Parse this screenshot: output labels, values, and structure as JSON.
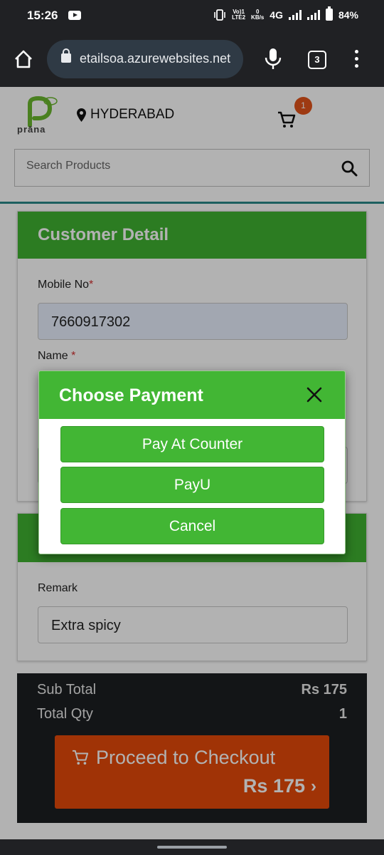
{
  "status_bar": {
    "time": "15:26",
    "net_line1": "Vo)1",
    "net_line2": "LTE2",
    "speed_line1": "0",
    "speed_line2": "KB/s",
    "network": "4G",
    "battery": "84%"
  },
  "browser": {
    "url": "etailsoa.azurewebsites.net",
    "tab_count": "3"
  },
  "header": {
    "logo_text": "prāna",
    "city": "HYDERABAD",
    "cart_count": "1"
  },
  "search": {
    "placeholder": "Search Products"
  },
  "customer_detail": {
    "title": "Customer Detail",
    "mobile_label": "Mobile No",
    "mobile_value": "7660917302",
    "name_label": "Name ",
    "required_mark": "*"
  },
  "remark_section": {
    "label": "Remark",
    "value": "Extra spicy"
  },
  "summary": {
    "subtotal_label": "Sub Total",
    "subtotal_value": "Rs 175",
    "qty_label": "Total Qty",
    "qty_value": "1",
    "checkout_label": "Proceed to Checkout",
    "checkout_amount": "Rs 175",
    "chevron": "›"
  },
  "payment_modal": {
    "title": "Choose Payment",
    "options": [
      "Pay At Counter",
      "PayU",
      "Cancel"
    ]
  },
  "colors": {
    "brand_green": "#42b634",
    "checkout_orange": "#e64a0a",
    "badge": "#e2541b"
  }
}
